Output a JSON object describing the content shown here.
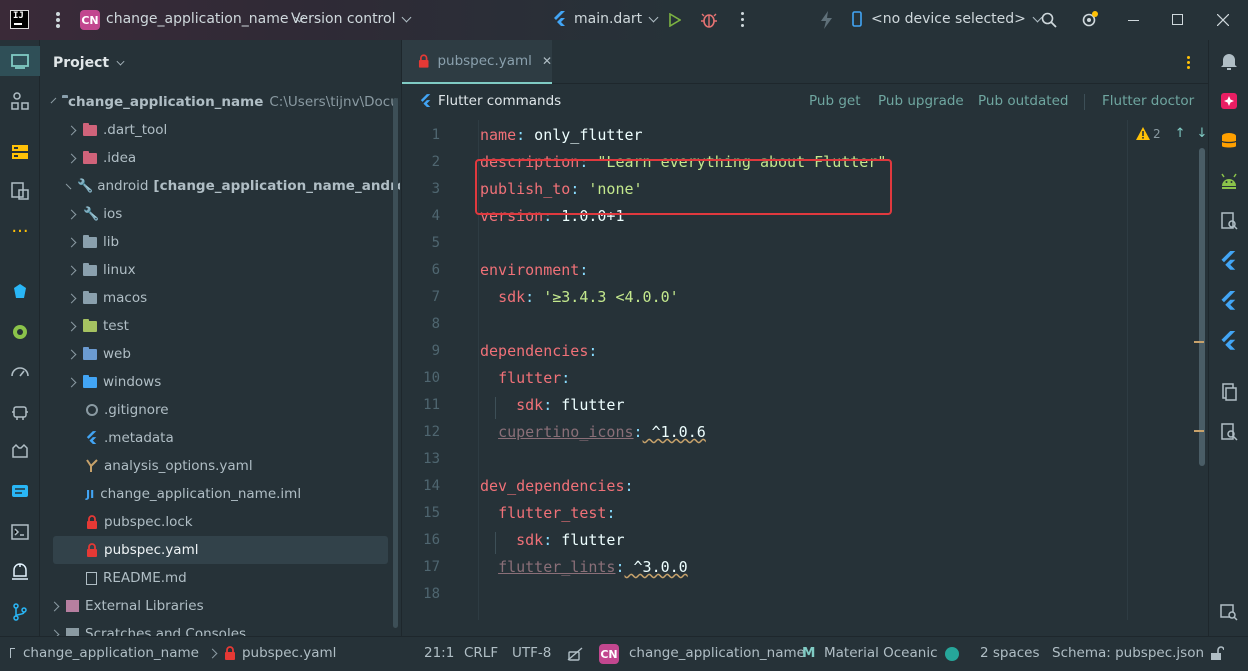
{
  "titlebar": {
    "project_badge": "CN",
    "project_name": "change_application_name",
    "version_control": "Version control",
    "run_config": "main.dart",
    "device": "<no device selected>"
  },
  "project_panel": {
    "title": "Project",
    "root": {
      "name": "change_application_name",
      "path": "C:\\Users\\tijnv\\Documen"
    },
    "items": [
      {
        "label": ".dart_tool",
        "color": "#d0637a"
      },
      {
        "label": ".idea",
        "color": "#d0637a"
      },
      {
        "label": "android",
        "suffix": "[change_application_name_android]"
      },
      {
        "label": "ios"
      },
      {
        "label": "lib"
      },
      {
        "label": "linux"
      },
      {
        "label": "macos"
      },
      {
        "label": "test",
        "color": "#a5c261"
      },
      {
        "label": "web"
      },
      {
        "label": "windows"
      },
      {
        "label": ".gitignore"
      },
      {
        "label": ".metadata"
      },
      {
        "label": "analysis_options.yaml"
      },
      {
        "label": "change_application_name.iml"
      },
      {
        "label": "pubspec.lock"
      },
      {
        "label": "pubspec.yaml"
      },
      {
        "label": "README.md"
      },
      {
        "label": "External Libraries"
      },
      {
        "label": "Scratches and Consoles"
      }
    ]
  },
  "editor": {
    "tab_label": "pubspec.yaml",
    "flutter_commands_label": "Flutter commands",
    "actions": [
      "Pub get",
      "Pub upgrade",
      "Pub outdated",
      "Flutter doctor"
    ],
    "warning_count": "2",
    "line_numbers": [
      "1",
      "2",
      "3",
      "4",
      "5",
      "6",
      "7",
      "8",
      "9",
      "10",
      "11",
      "12",
      "13",
      "14",
      "15",
      "16",
      "17",
      "18"
    ],
    "lines": [
      {
        "key": "name",
        "value": " only_flutter",
        "indent": ""
      },
      {
        "key": "description",
        "value": " \"Learn everything about Flutter\"",
        "indent": "",
        "string": true
      },
      {
        "key": "publish_to",
        "value": " 'none'",
        "indent": "",
        "string": true
      },
      {
        "key": "version",
        "value": " 1.0.0+1",
        "indent": ""
      },
      {},
      {
        "key": "environment",
        "value": "",
        "indent": ""
      },
      {
        "key": "sdk",
        "value": " '≥3.4.3 <4.0.0'",
        "indent": "  ",
        "string": true
      },
      {},
      {
        "key": "dependencies",
        "value": "",
        "indent": ""
      },
      {
        "key": "flutter",
        "value": "",
        "indent": "  "
      },
      {
        "key": "sdk",
        "value": " flutter",
        "indent": "    "
      },
      {
        "key": "cupertino_icons",
        "value": " ^1.0.6",
        "indent": "  "
      },
      {},
      {
        "key": "dev_dependencies",
        "value": "",
        "indent": ""
      },
      {
        "key": "flutter_test",
        "value": "",
        "indent": "  "
      },
      {
        "key": "sdk",
        "value": " flutter",
        "indent": "    "
      },
      {
        "key": "flutter_lints",
        "value": " ^3.0.0",
        "indent": "  "
      },
      {}
    ]
  },
  "statusbar": {
    "breadcrumb_project": "change_application_name",
    "breadcrumb_file": "pubspec.yaml",
    "position": "21:1",
    "line_ending": "CRLF",
    "encoding": "UTF-8",
    "badge": "CN",
    "module": "change_application_name",
    "theme": "Material Oceanic",
    "indent": "2 spaces",
    "schema": "Schema: pubspec.json"
  },
  "colors": {
    "background": "#263238",
    "accent": "#80cbc4",
    "highlight_box": "#e0393e",
    "key": "#f07178",
    "string": "#c3e88d"
  }
}
